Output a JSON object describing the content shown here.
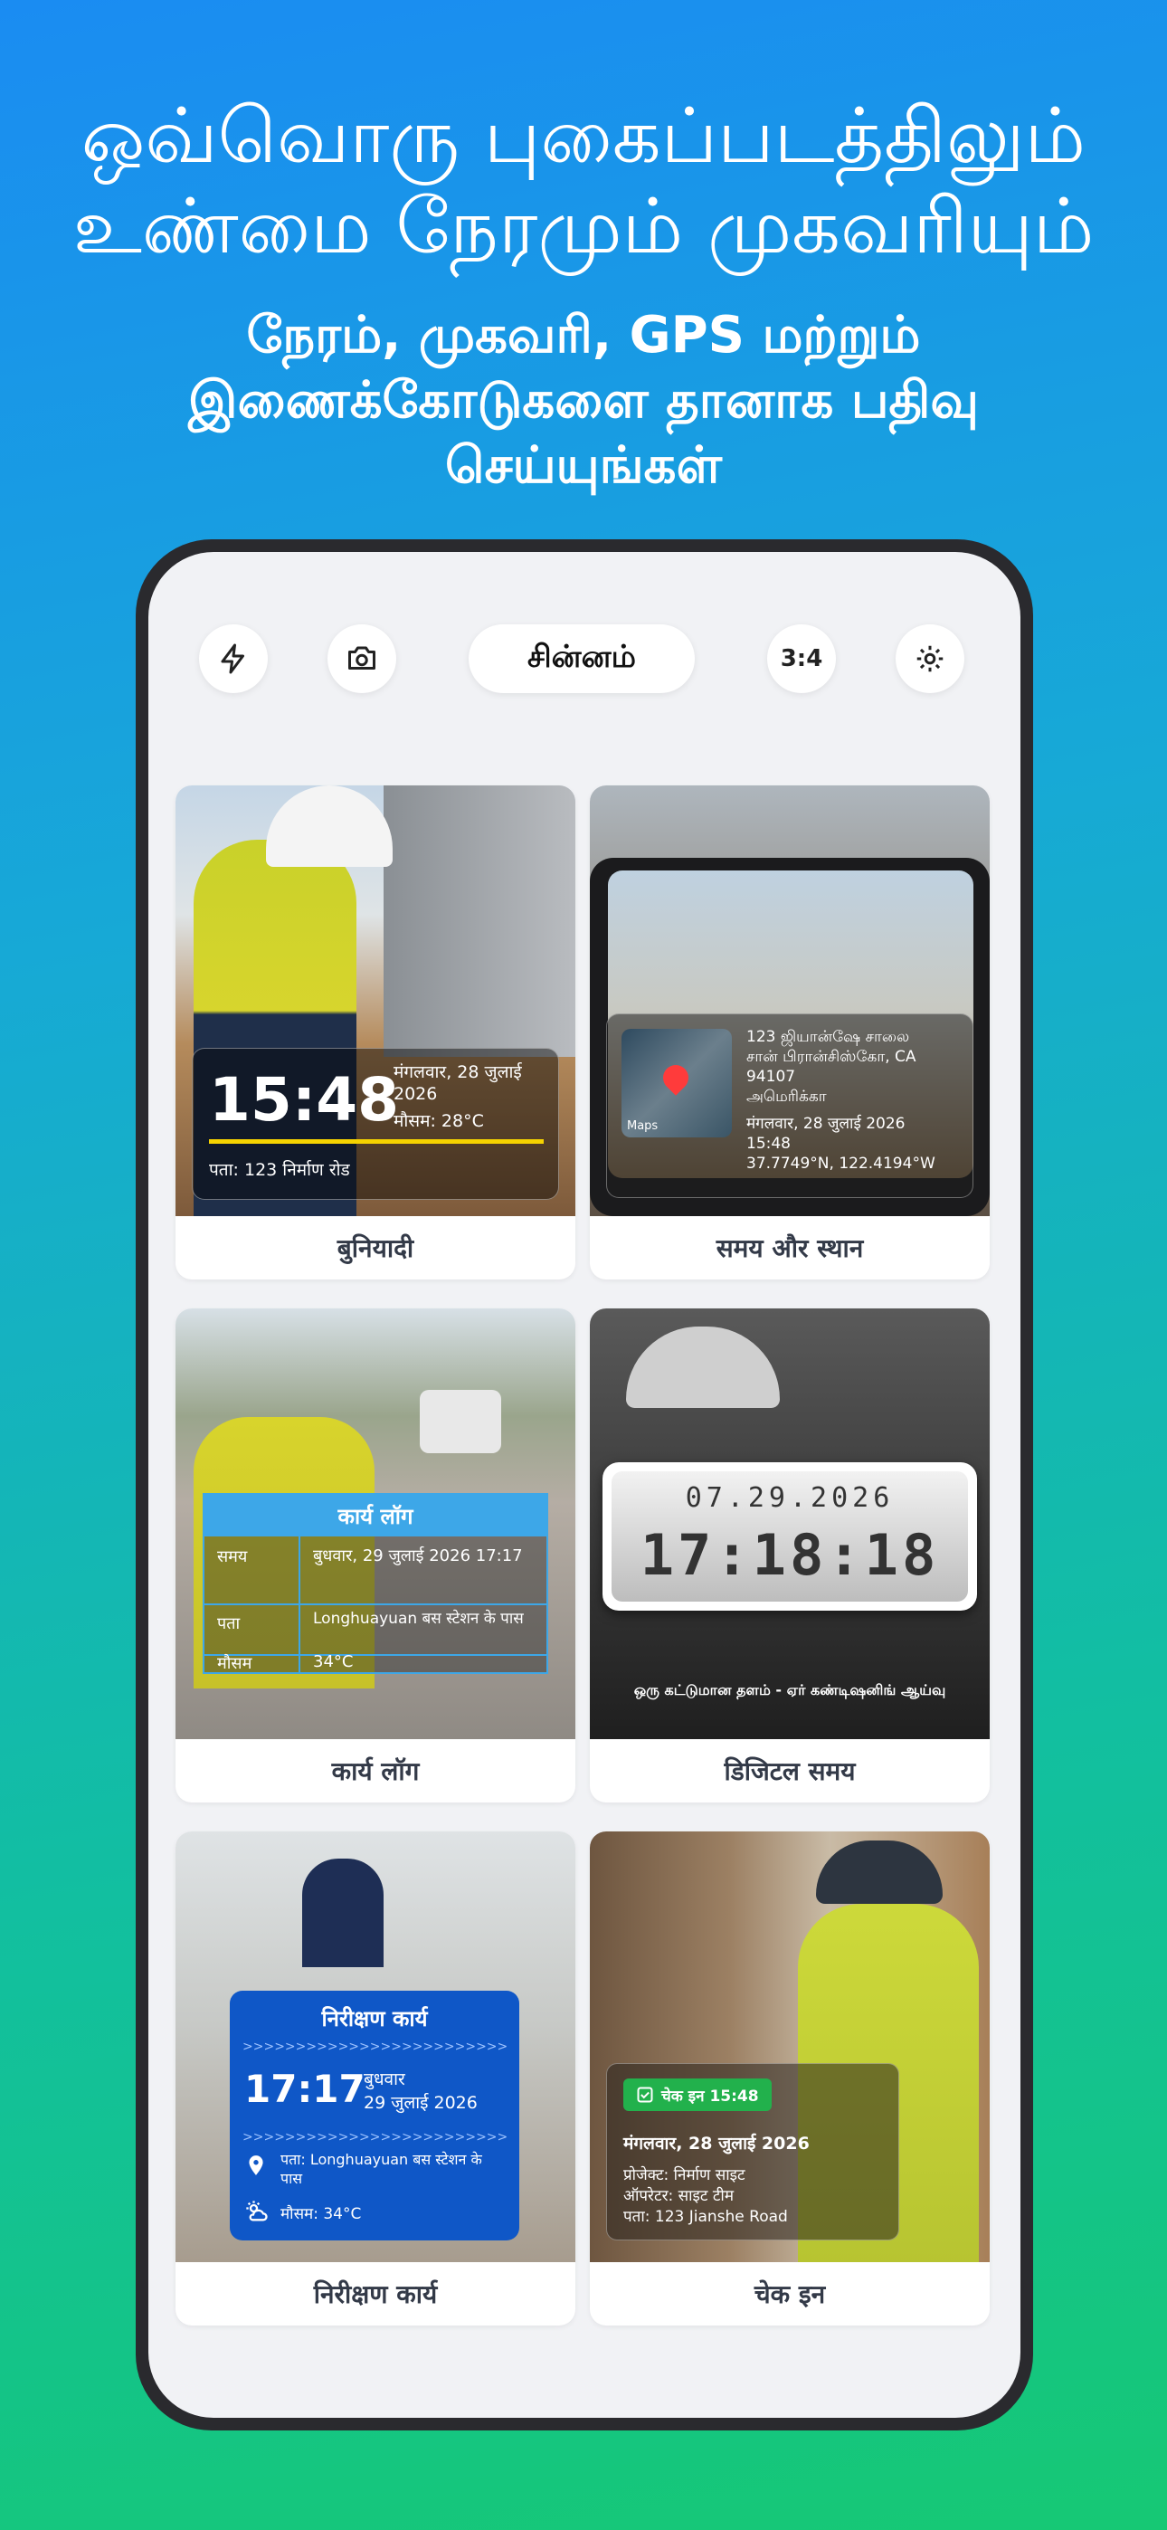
{
  "headline": {
    "line1": "ஒவ்வொரு புகைப்படத்திலும்",
    "line2": "உண்மை நேரமும் முகவரியும்"
  },
  "subheadline": {
    "line1": "நேரம், முகவரி, GPS மற்றும்",
    "line2": "இணைக்கோடுகளை தானாக பதிவு",
    "line3": "செய்யுங்கள்"
  },
  "toolbar": {
    "flash_icon": "lightning-icon",
    "camera_icon": "camera-icon",
    "template_label": "சின்னம்",
    "ratio_label": "3:4",
    "settings_icon": "gear-icon"
  },
  "cards": [
    {
      "label": "बुनियादी",
      "time": "15:48",
      "date": "मंगलवार, 28 जुलाई 2026",
      "weather": "मौसम: 28°C",
      "address": "पता: 123 निर्माण रोड",
      "accent": "#f5d200"
    },
    {
      "label": "समय और स्थान",
      "addr1": "123 ஜியான்ஷே சாலை",
      "addr2": "சான் பிரான்சிஸ்கோ, CA",
      "addr3": "94107",
      "addr4": "அமெரிக்கா",
      "date": "मंगलवार, 28 जुलाई 2026",
      "time": "15:48",
      "coords": "37.7749°N, 122.4194°W",
      "map_brand": "Maps"
    },
    {
      "label": "कार्य लॉग",
      "title": "कार्य लॉग",
      "rows": [
        {
          "k": "समय",
          "v": "बुधवार, 29 जुलाई 2026 17:17"
        },
        {
          "k": "पता",
          "v": "Longhuayuan बस स्टेशन के पास"
        },
        {
          "k": "मौसम",
          "v": "34°C"
        }
      ]
    },
    {
      "label": "डिजिटल समय",
      "date": "07.29.2026",
      "time": "17:18:18",
      "caption": "ஒரு கட்டுமான தளம் - ஏர் கண்டிஷனிங் ஆய்வு"
    },
    {
      "label": "निरीक्षण कार्य",
      "title": "निरीक्षण कार्य",
      "arrows": ">>>>>>>>>>>>>>>>>>>>>>>>>>>>>>",
      "time": "17:17",
      "day": "बुधवार",
      "date": "29 जुलाई 2026",
      "address": "पता: Longhuayuan बस स्टेशन के पास",
      "weather": "मौसम: 34°C"
    },
    {
      "label": "चेक इन",
      "badge": "चेक इन 15:48",
      "date": "मंगलवार, 28 जुलाई 2026",
      "project": "प्रोजेक्ट: निर्माण साइट",
      "operator": "ऑपरेटर: साइट टीम",
      "address": "पता: 123 Jianshe Road",
      "badge_color": "#22b14c"
    }
  ]
}
